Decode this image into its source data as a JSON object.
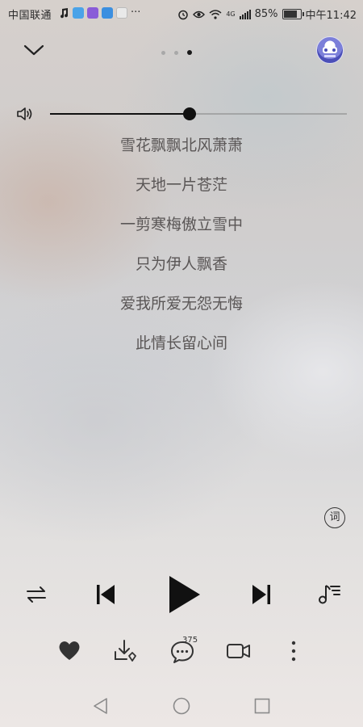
{
  "status_bar": {
    "carrier": "中国联通",
    "overflow": "···",
    "signal_type": "4G",
    "battery": "85%",
    "battery_level": 0.85,
    "time": "中午11:42",
    "icons": [
      "music-note-icon",
      "app-shield-icon",
      "app-video-icon",
      "app-browser-icon",
      "app-camera-icon",
      "alarm-icon",
      "eye-icon",
      "wifi-icon",
      "signal-icon"
    ]
  },
  "header": {
    "pager_count": 3,
    "pager_active": 3
  },
  "volume": {
    "level": 0.47
  },
  "lyrics": {
    "lines": [
      "雪花飘飘北风萧萧",
      "天地一片苍茫",
      "一剪寒梅傲立雪中",
      "只为伊人飘香",
      "爱我所爱无怨无悔",
      "此情长留心间"
    ]
  },
  "lyric_toggle_label": "词",
  "actions": {
    "comment_count": "375"
  },
  "colors": {
    "accent": "#111111",
    "lyric_text": "#5a5656"
  }
}
